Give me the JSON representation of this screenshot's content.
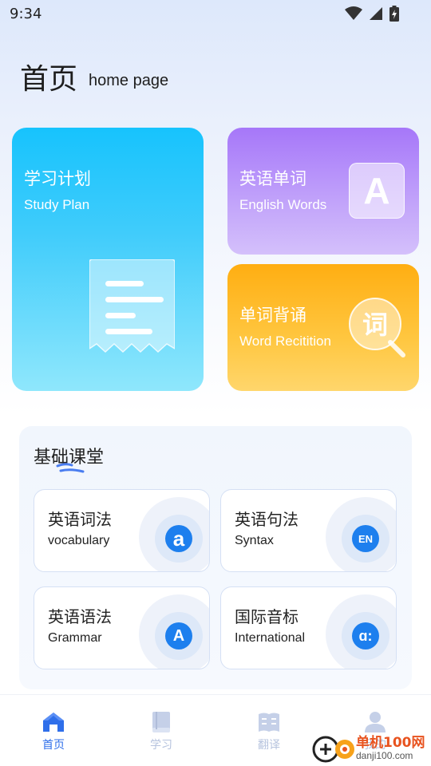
{
  "status_bar": {
    "time": "9:34"
  },
  "header": {
    "title": "首页",
    "subtitle": "home page"
  },
  "cards": {
    "study_plan": {
      "title": "学习计划",
      "subtitle": "Study Plan"
    },
    "english_words": {
      "title": "英语单词",
      "subtitle": "English Words",
      "icon_letter": "A"
    },
    "word_recitation": {
      "title": "单词背诵",
      "subtitle": "Word Recitition",
      "icon_char": "词"
    }
  },
  "section": {
    "title": "基础课堂",
    "tiles": [
      {
        "title": "英语词法",
        "subtitle": "vocabulary",
        "icon": "a"
      },
      {
        "title": "英语句法",
        "subtitle": "Syntax",
        "icon": "EN"
      },
      {
        "title": "英语语法",
        "subtitle": "Grammar",
        "icon": "A"
      },
      {
        "title": "国际音标",
        "subtitle": "International",
        "icon": "ɑ:"
      }
    ]
  },
  "bottom_nav": {
    "items": [
      {
        "label": "首页",
        "icon": "home-icon",
        "active": true
      },
      {
        "label": "学习",
        "icon": "book-icon",
        "active": false
      },
      {
        "label": "翻译",
        "icon": "translate-icon",
        "active": false
      },
      {
        "label": "我的",
        "icon": "user-icon",
        "active": false
      }
    ]
  },
  "watermark": {
    "name": "单机100网",
    "url": "danji100.com"
  },
  "colors": {
    "accent": "#2f6fea",
    "study_card": "#17c3fd",
    "words_card": "#a677f9",
    "recite_card": "#ffae12",
    "tile_icon": "#1d7fee"
  }
}
